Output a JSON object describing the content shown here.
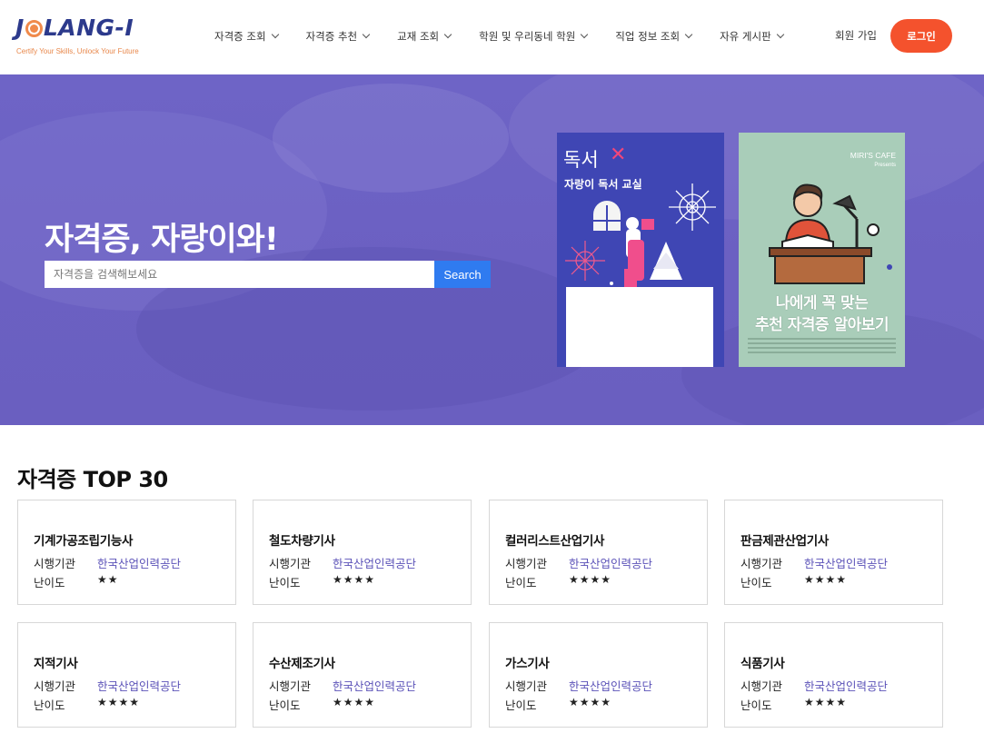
{
  "header": {
    "logo_text_1": "J",
    "logo_text_2": "LANG-I",
    "tagline": "Certify Your Skills, Unlock Your Future",
    "nav": [
      {
        "label": "자격증 조회"
      },
      {
        "label": "자격증 추천"
      },
      {
        "label": "교재 조회"
      },
      {
        "label": "학원 및 우리동네 학원"
      },
      {
        "label": "직업 정보 조회"
      },
      {
        "label": "자유 게시판"
      }
    ],
    "signup_label": "회원 가입",
    "login_label": "로그인",
    "colors": {
      "brand": "#2c3a8c",
      "accent": "#f4522d"
    }
  },
  "hero": {
    "title": "자격증, 자랑이와!",
    "search_placeholder": "자격증을 검색해보세요",
    "search_button": "Search",
    "banners": [
      {
        "title": "독서",
        "subtitle": "자랑이 독서 교실"
      },
      {
        "brand": "MIRI'S CAFE",
        "brand_sub": "Presents",
        "headline_1": "나에게 꼭 맞는",
        "headline_2": "추천 자격증 알아보기"
      }
    ]
  },
  "top30": {
    "title": "자격증 TOP 30",
    "org_label": "시행기관",
    "difficulty_label": "난이도",
    "cards": [
      {
        "name": "기계가공조립기능사",
        "org": "한국산업인력공단",
        "difficulty": "★★"
      },
      {
        "name": "철도차량기사",
        "org": "한국산업인력공단",
        "difficulty": "★★★★"
      },
      {
        "name": "컬러리스트산업기사",
        "org": "한국산업인력공단",
        "difficulty": "★★★★"
      },
      {
        "name": "판금제관산업기사",
        "org": "한국산업인력공단",
        "difficulty": "★★★★"
      },
      {
        "name": "지적기사",
        "org": "한국산업인력공단",
        "difficulty": "★★★★"
      },
      {
        "name": "수산제조기사",
        "org": "한국산업인력공단",
        "difficulty": "★★★★"
      },
      {
        "name": "가스기사",
        "org": "한국산업인력공단",
        "difficulty": "★★★★"
      },
      {
        "name": "식품기사",
        "org": "한국산업인력공단",
        "difficulty": "★★★★"
      }
    ]
  }
}
